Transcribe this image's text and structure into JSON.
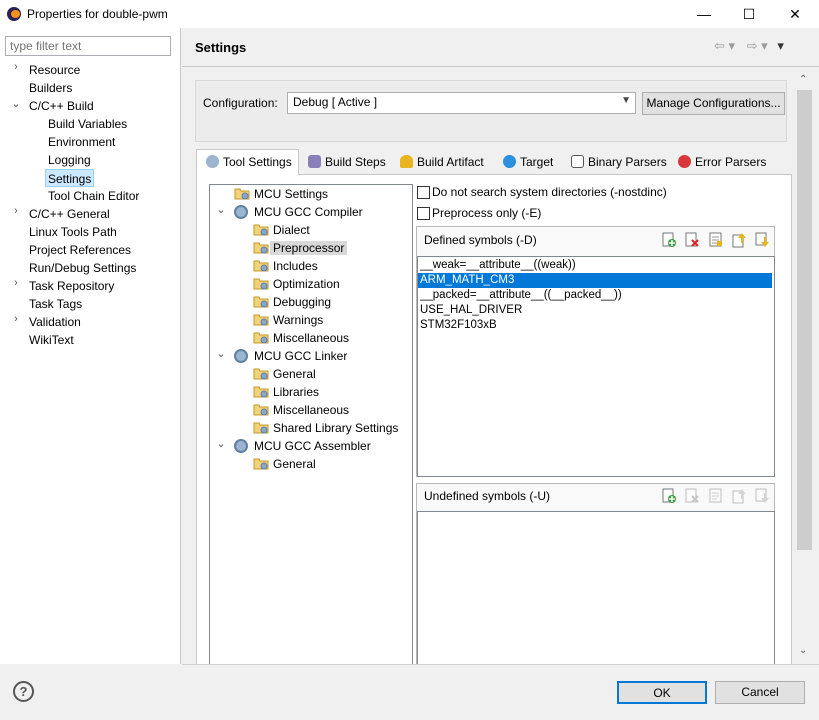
{
  "window": {
    "title": "Properties for double-pwm",
    "min": "—",
    "max": "☐",
    "close": "✕"
  },
  "filter": {
    "placeholder": "type filter text"
  },
  "nav": [
    {
      "label": "Resource",
      "chev": "›"
    },
    {
      "label": "Builders",
      "chev": ""
    },
    {
      "label": "C/C++ Build",
      "chev": "⌄"
    },
    {
      "label": "Build Variables",
      "chev": ""
    },
    {
      "label": "Environment",
      "chev": ""
    },
    {
      "label": "Logging",
      "chev": ""
    },
    {
      "label": "Settings",
      "chev": ""
    },
    {
      "label": "Tool Chain Editor",
      "chev": ""
    },
    {
      "label": "C/C++ General",
      "chev": "›"
    },
    {
      "label": "Linux Tools Path",
      "chev": ""
    },
    {
      "label": "Project References",
      "chev": ""
    },
    {
      "label": "Run/Debug Settings",
      "chev": ""
    },
    {
      "label": "Task Repository",
      "chev": "›"
    },
    {
      "label": "Task Tags",
      "chev": ""
    },
    {
      "label": "Validation",
      "chev": "›"
    },
    {
      "label": "WikiText",
      "chev": ""
    }
  ],
  "page_title": "Settings",
  "history": {
    "back": "⇦ ▾",
    "forward": "⇨ ▾",
    "menu": "▾"
  },
  "configuration": {
    "label": "Configuration:",
    "value": "Debug  [ Active ]",
    "manage": "Manage Configurations..."
  },
  "tabs": [
    "Tool Settings",
    "Build Steps",
    "Build Artifact",
    "Target",
    "Binary Parsers",
    "Error Parsers"
  ],
  "tool_tree": [
    {
      "label": "MCU Settings"
    },
    {
      "label": "MCU GCC Compiler"
    },
    {
      "label": "Dialect"
    },
    {
      "label": "Preprocessor"
    },
    {
      "label": "Includes"
    },
    {
      "label": "Optimization"
    },
    {
      "label": "Debugging"
    },
    {
      "label": "Warnings"
    },
    {
      "label": "Miscellaneous"
    },
    {
      "label": "MCU GCC Linker"
    },
    {
      "label": "General"
    },
    {
      "label": "Libraries"
    },
    {
      "label": "Miscellaneous"
    },
    {
      "label": "Shared Library Settings"
    },
    {
      "label": "MCU GCC Assembler"
    },
    {
      "label": "General"
    }
  ],
  "options": {
    "nostdinc": {
      "label": "Do not search system directories (-nostdinc)",
      "checked": false
    },
    "preprocess_only": {
      "label": "Preprocess only (-E)",
      "checked": false
    }
  },
  "defined": {
    "title": "Defined symbols (-D)",
    "items": [
      "__weak=__attribute__((weak))",
      "ARM_MATH_CM3",
      "__packed=__attribute__((__packed__))",
      "USE_HAL_DRIVER",
      "STM32F103xB"
    ],
    "selected_index": 1
  },
  "undefined": {
    "title": "Undefined symbols (-U)",
    "items": []
  },
  "buttons": {
    "help": "?",
    "ok": "OK",
    "cancel": "Cancel"
  },
  "colors": {
    "selection": "#0078d7",
    "nav_selection": "#cce8ff"
  }
}
